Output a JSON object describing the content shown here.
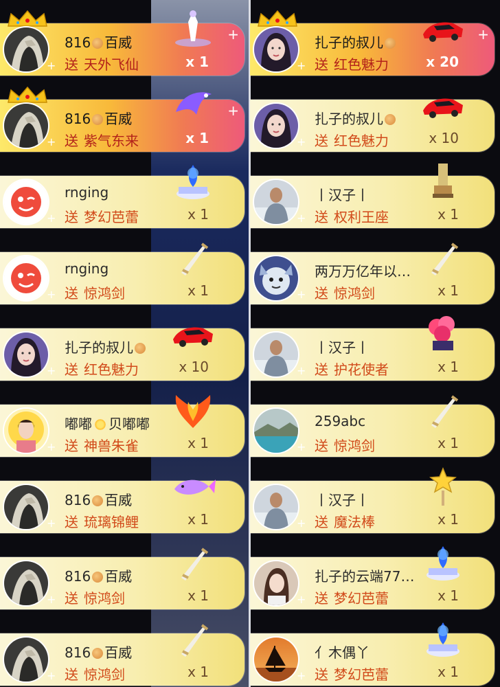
{
  "left_column": [
    {
      "name": "816",
      "badge": "bear-badge-icon",
      "name_suffix": "百威",
      "verb": "送",
      "gift": "天外飞仙",
      "count": "x 1",
      "style": "premium",
      "crown": true,
      "avatar": "hooded-figure",
      "gift_icon": "fairy-icon"
    },
    {
      "name": "816",
      "badge": "bear-badge-icon",
      "name_suffix": "百威",
      "verb": "送",
      "gift": "紫气东来",
      "count": "x 1",
      "style": "premium",
      "crown": true,
      "avatar": "hooded-figure",
      "gift_icon": "purple-dragon-icon"
    },
    {
      "name": "rnging",
      "badge": "",
      "name_suffix": "",
      "verb": "送",
      "gift": "梦幻芭蕾",
      "count": "x 1",
      "style": "normal",
      "crown": false,
      "avatar": "red-wink",
      "gift_icon": "ballet-music-box-icon"
    },
    {
      "name": "rnging",
      "badge": "",
      "name_suffix": "",
      "verb": "送",
      "gift": "惊鸿剑",
      "count": "x 1",
      "style": "normal",
      "crown": false,
      "avatar": "red-wink",
      "gift_icon": "sword-icon"
    },
    {
      "name": "扎子的叔儿",
      "badge": "bear-badge-icon",
      "name_suffix": "",
      "verb": "送",
      "gift": "红色魅力",
      "count": "x 10",
      "style": "normal",
      "crown": false,
      "avatar": "woman-portrait",
      "gift_icon": "red-sports-car-icon"
    },
    {
      "name": "嘟嘟",
      "badge": "sun-badge-icon",
      "name_suffix": "贝嘟嘟",
      "verb": "送",
      "gift": "神兽朱雀",
      "count": "x 1",
      "style": "normal",
      "crown": false,
      "avatar": "golden-halo-woman",
      "gift_icon": "phoenix-icon"
    },
    {
      "name": "816",
      "badge": "bear-badge-icon",
      "name_suffix": "百威",
      "verb": "送",
      "gift": "琉璃锦鲤",
      "count": "x 1",
      "style": "normal",
      "crown": false,
      "avatar": "hooded-figure",
      "gift_icon": "koi-fish-icon"
    },
    {
      "name": "816",
      "badge": "bear-badge-icon",
      "name_suffix": "百威",
      "verb": "送",
      "gift": "惊鸿剑",
      "count": "x 1",
      "style": "normal",
      "crown": false,
      "avatar": "hooded-figure",
      "gift_icon": "sword-icon"
    },
    {
      "name": "816",
      "badge": "bear-badge-icon",
      "name_suffix": "百威",
      "verb": "送",
      "gift": "惊鸿剑",
      "count": "x 1",
      "style": "normal",
      "crown": false,
      "avatar": "hooded-figure",
      "gift_icon": "sword-icon"
    }
  ],
  "right_column": [
    {
      "name": "扎子的叔儿",
      "badge": "bear-badge-icon",
      "name_suffix": "",
      "verb": "送",
      "gift": "红色魅力",
      "count": "x 20",
      "style": "premium",
      "crown": true,
      "avatar": "woman-portrait",
      "gift_icon": "red-sports-car-icon"
    },
    {
      "name": "扎子的叔儿",
      "badge": "bear-badge-icon",
      "name_suffix": "",
      "verb": "送",
      "gift": "红色魅力",
      "count": "x 10",
      "style": "normal",
      "crown": false,
      "avatar": "woman-portrait",
      "gift_icon": "red-sports-car-icon"
    },
    {
      "name": "丨汉子丨",
      "badge": "",
      "name_suffix": "",
      "verb": "送",
      "gift": "权利王座",
      "count": "x 1",
      "style": "normal",
      "crown": false,
      "avatar": "man-portrait",
      "gift_icon": "throne-icon"
    },
    {
      "name": "两万万亿年以…",
      "badge": "",
      "name_suffix": "",
      "verb": "送",
      "gift": "惊鸿剑",
      "count": "x 1",
      "style": "normal",
      "crown": false,
      "avatar": "snow-wolf",
      "gift_icon": "sword-icon"
    },
    {
      "name": "丨汉子丨",
      "badge": "",
      "name_suffix": "",
      "verb": "送",
      "gift": "护花使者",
      "count": "x 1",
      "style": "normal",
      "crown": false,
      "avatar": "man-portrait",
      "gift_icon": "flower-guardian-icon"
    },
    {
      "name": "259abc",
      "badge": "",
      "name_suffix": "",
      "verb": "送",
      "gift": "惊鸿剑",
      "count": "x 1",
      "style": "normal",
      "crown": false,
      "avatar": "lake-landscape",
      "gift_icon": "sword-icon"
    },
    {
      "name": "丨汉子丨",
      "badge": "",
      "name_suffix": "",
      "verb": "送",
      "gift": "魔法棒",
      "count": "x 1",
      "style": "normal",
      "crown": false,
      "avatar": "man-portrait",
      "gift_icon": "magic-wand-icon"
    },
    {
      "name": "扎子的云端77…",
      "badge": "",
      "name_suffix": "",
      "verb": "送",
      "gift": "梦幻芭蕾",
      "count": "x 1",
      "style": "normal",
      "crown": false,
      "avatar": "woman-selfie",
      "gift_icon": "ballet-music-box-icon"
    },
    {
      "name": "亻木偶丫",
      "badge": "",
      "name_suffix": "",
      "verb": "送",
      "gift": "梦幻芭蕾",
      "count": "x 1",
      "style": "normal",
      "crown": false,
      "avatar": "sailboat-sunset",
      "gift_icon": "ballet-music-box-icon"
    }
  ],
  "colors": {
    "premium_start": "#fde96a",
    "premium_end": "#ee5a7a",
    "normal_start": "#fbf6d7",
    "normal_end": "#f2e07a",
    "gift_text": "#d14a1a"
  }
}
